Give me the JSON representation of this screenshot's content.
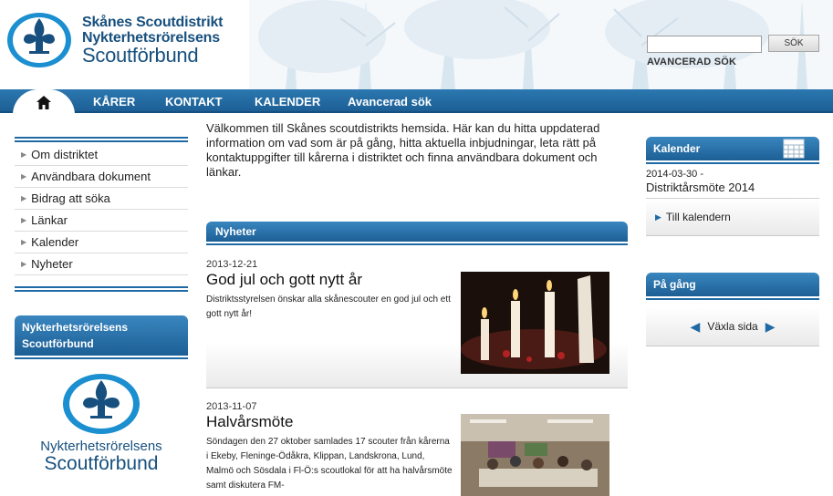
{
  "header": {
    "logo_line1": "Skånes Scoutdistrikt",
    "logo_line2": "Nykterhetsrörelsens",
    "logo_line3": "Scoutförbund",
    "search_placeholder": "",
    "search_button": "SÖK",
    "advanced_search": "AVANCERAD SÖK"
  },
  "nav": {
    "home_icon": "home-icon",
    "items": [
      "KÅRER",
      "KONTAKT",
      "KALENDER",
      "Avancerad sök"
    ]
  },
  "left_menu": {
    "items": [
      "Om distriktet",
      "Användbara dokument",
      "Bidrag att söka",
      "Länkar",
      "Kalender",
      "Nyheter"
    ]
  },
  "left_box": {
    "title_line1": "Nykterhetsrörelsens",
    "title_line2": "Scoutförbund",
    "logo_line1": "Nykterhetsrörelsens",
    "logo_line2": "Scoutförbund"
  },
  "intro": "Välkommen till Skånes scoutdistrikts hemsida. Här kan du hitta uppdaterad information om vad som är på gång, hitta aktuella inbjudningar, leta rätt på kontaktuppgifter till kårerna i distriktet och finna användbara dokument och länkar.",
  "news": {
    "heading": "Nyheter",
    "items": [
      {
        "date": "2013-12-21",
        "title": "God jul och gott nytt år",
        "text": "Distriktsstyrelsen önskar alla skånescouter en god jul och ett gott nytt år!"
      },
      {
        "date": "2013-11-07",
        "title": "Halvårsmöte",
        "text": "Söndagen den 27 oktober samlades 17 scouter från kårerna i Ekeby, Fleninge-Ödåkra, Klippan, Landskrona, Lund, Malmö och Sösdala i Fl-Ö:s scoutlokal för att ha halvårsmöte samt diskutera FM-"
      }
    ]
  },
  "calendar": {
    "heading": "Kalender",
    "date": "2014-03-30 -",
    "event": "Distriktårsmöte 2014",
    "link": "Till kalendern"
  },
  "pa_gang": {
    "heading": "På gång",
    "label": "Växla sida"
  },
  "colors": {
    "brand_blue": "#1f6aa5",
    "logo_blue": "#17507e"
  }
}
